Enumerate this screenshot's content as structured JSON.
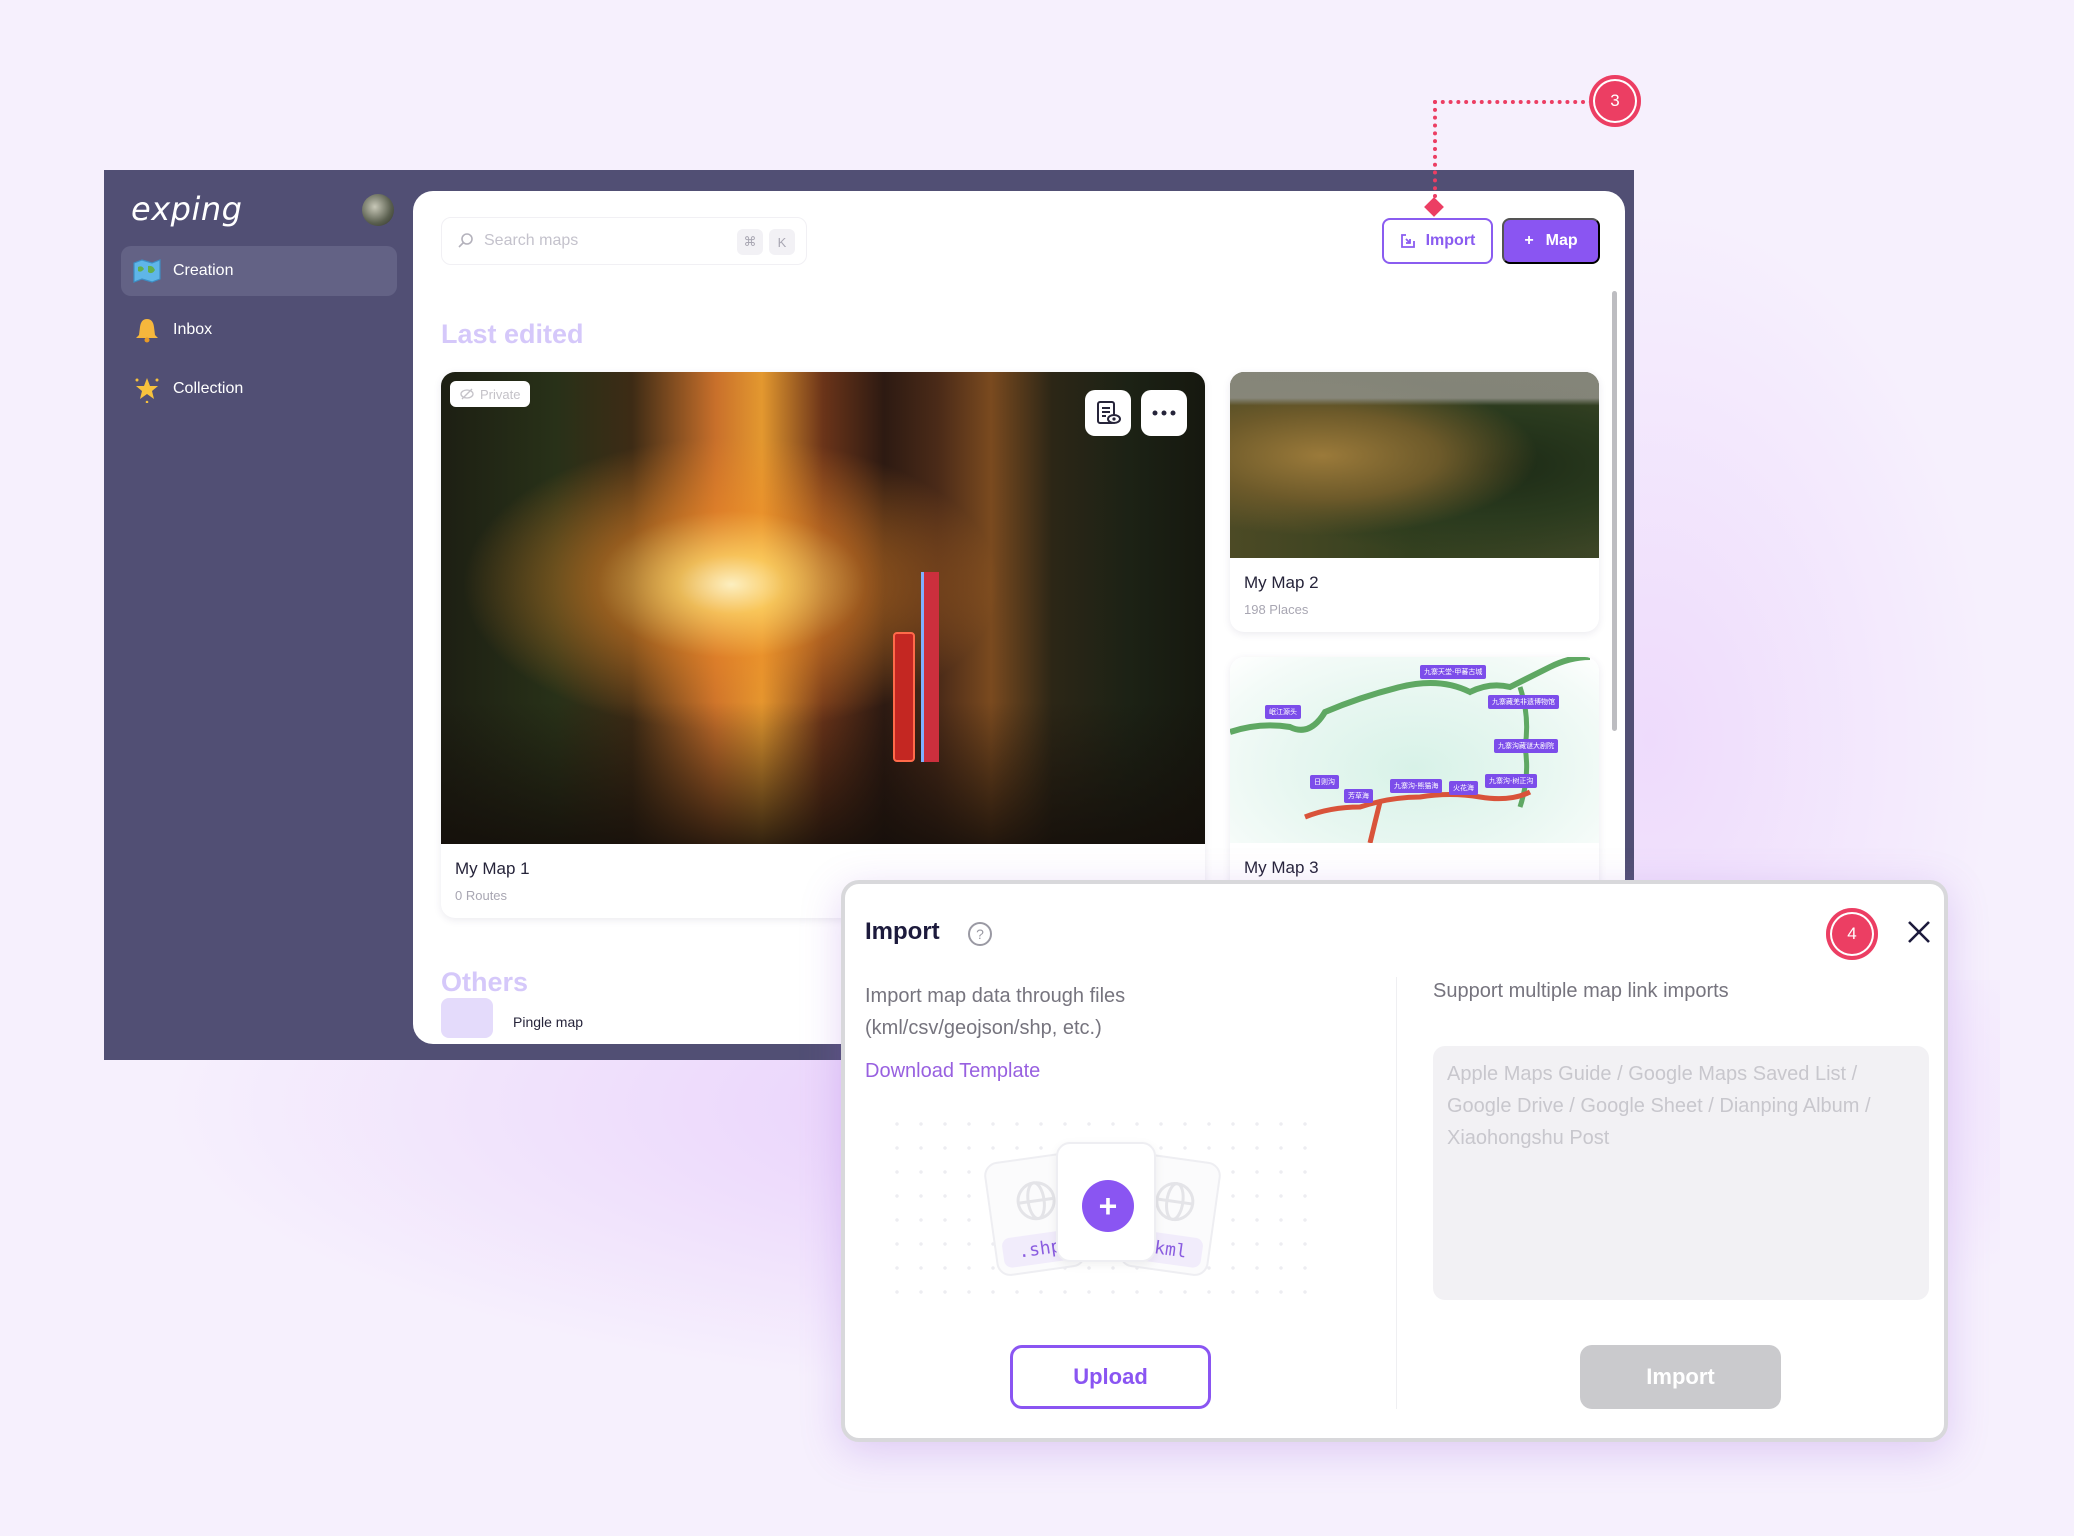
{
  "app": {
    "logo": "exping",
    "accent_color": "#8a55f2",
    "annotation_color": "#ec3e63"
  },
  "annotations": [
    {
      "number": "3",
      "target": "import-button"
    },
    {
      "number": "4",
      "target": "import-modal"
    }
  ],
  "sidebar": {
    "items": [
      {
        "label": "Creation",
        "icon": "map-icon",
        "active": true
      },
      {
        "label": "Inbox",
        "icon": "bell-icon",
        "active": false
      },
      {
        "label": "Collection",
        "icon": "star-icon",
        "active": false
      }
    ]
  },
  "header": {
    "search_placeholder": "Search maps",
    "shortcut_keys": [
      "⌘",
      "K"
    ],
    "import_label": "Import",
    "map_label": "Map",
    "map_prefix": "+"
  },
  "sections": {
    "last_edited": "Last edited",
    "others": "Others"
  },
  "cards": [
    {
      "title": "My Map 1",
      "subtitle": "0 Routes",
      "badge": "Private"
    },
    {
      "title": "My Map 2",
      "subtitle": "198 Places"
    },
    {
      "title": "My Map 3",
      "subtitle": ""
    }
  ],
  "map3_labels": [
    "九寨天堂-甲蕃古城",
    "岷江源头",
    "九寨藏羌非遗博物馆",
    "九寨沟藏谜大剧院",
    "日则沟",
    "芳草海",
    "九寨沟-熊猫海",
    "火花海",
    "九寨沟-树正沟"
  ],
  "others_rows": [
    {
      "title": "Pingle map"
    }
  ],
  "modal": {
    "title": "Import",
    "help_icon": "?",
    "description": "Import map data through files (kml/csv/geojson/shp, etc.)",
    "download_template": "Download Template",
    "file_types": [
      ".shp",
      ".kml"
    ],
    "upload_label": "Upload",
    "links_label": "Support multiple map link imports",
    "links_placeholder": "Apple Maps Guide / Google Maps Saved List / Google Drive / Google Sheet / Dianping Album / Xiaohongshu Post",
    "links_value": "",
    "import_label": "Import",
    "import_disabled": true
  }
}
